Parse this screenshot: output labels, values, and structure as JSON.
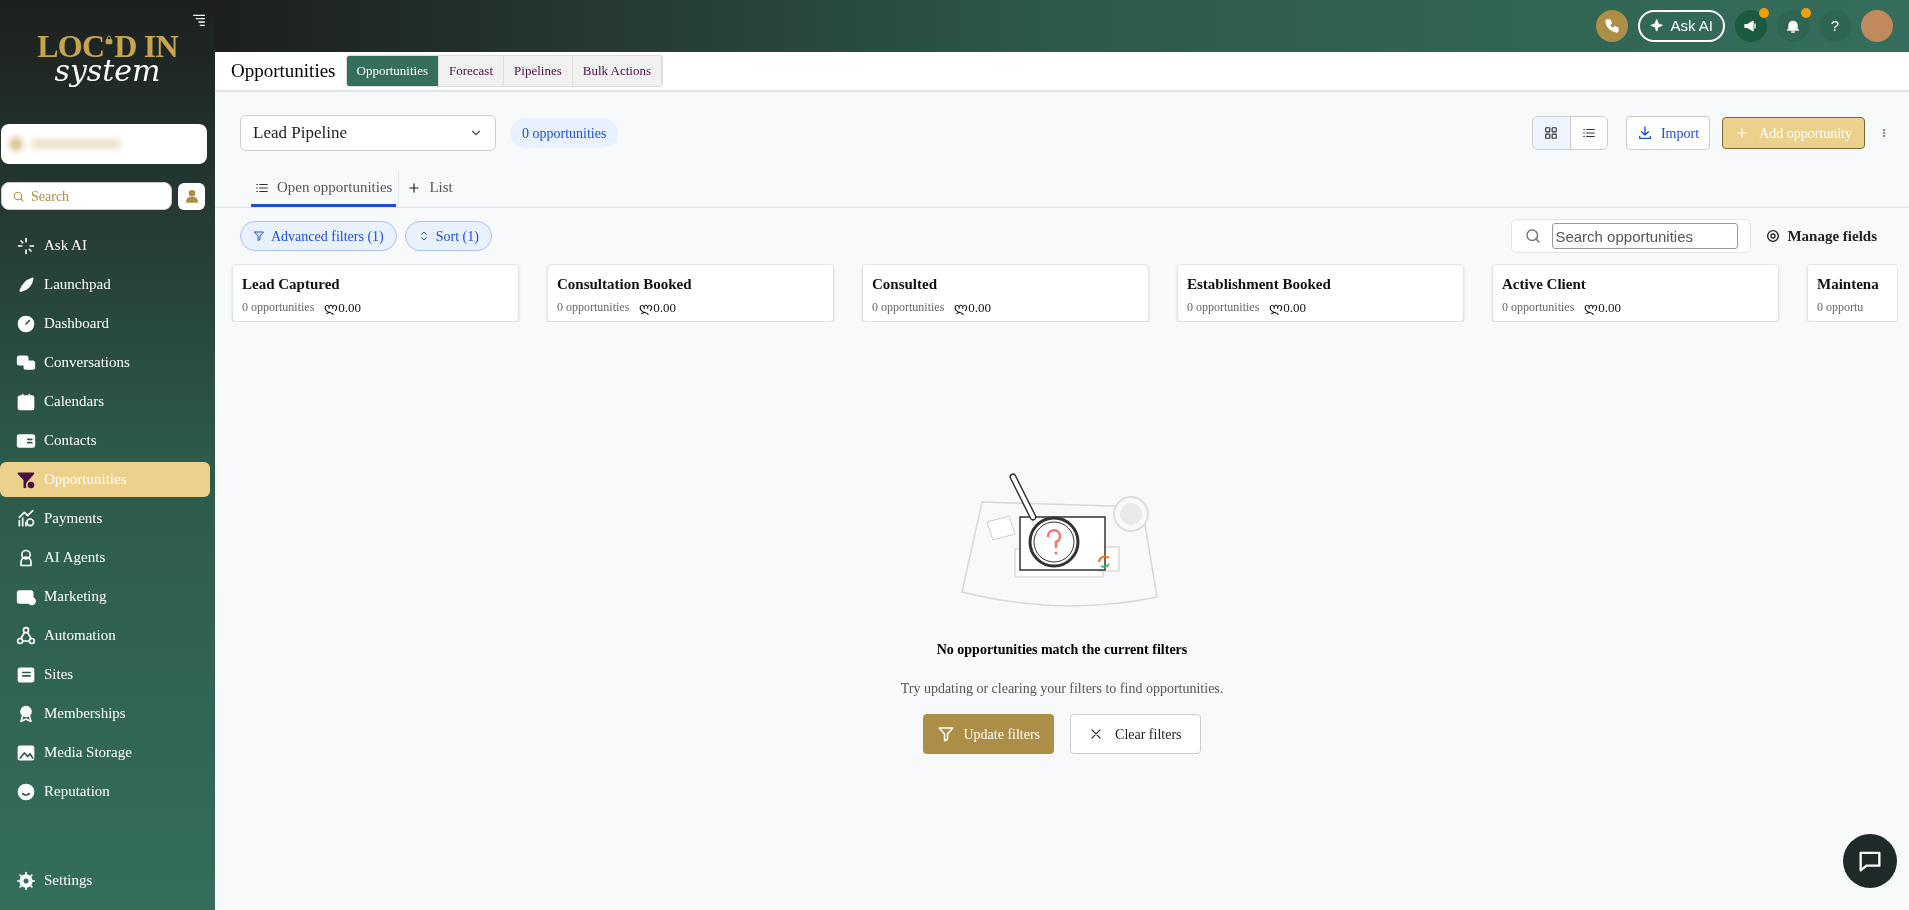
{
  "logo": {
    "top_left": "LOC",
    "top_right": "D IN",
    "script": "system"
  },
  "sidebar": {
    "search": {
      "placeholder": "Search"
    },
    "items": [
      {
        "label": "Ask AI",
        "selected": false
      },
      {
        "label": "Launchpad",
        "selected": false
      },
      {
        "label": "Dashboard",
        "selected": false
      },
      {
        "label": "Conversations",
        "selected": false
      },
      {
        "label": "Calendars",
        "selected": false
      },
      {
        "label": "Contacts",
        "selected": false
      },
      {
        "label": "Opportunities",
        "selected": true
      },
      {
        "label": "Payments",
        "selected": false
      },
      {
        "label": "AI Agents",
        "selected": false
      },
      {
        "label": "Marketing",
        "selected": false
      },
      {
        "label": "Automation",
        "selected": false
      },
      {
        "label": "Sites",
        "selected": false
      },
      {
        "label": "Memberships",
        "selected": false
      },
      {
        "label": "Media Storage",
        "selected": false
      },
      {
        "label": "Reputation",
        "selected": false
      }
    ],
    "footer_item": {
      "label": "Settings"
    }
  },
  "topbar": {
    "ask_ai": "Ask AI",
    "help": "?",
    "announcement_unread": true,
    "notification_unread": true
  },
  "page": {
    "title": "Opportunities",
    "tabs": [
      {
        "label": "Opportunities",
        "selected": true
      },
      {
        "label": "Forecast",
        "selected": false
      },
      {
        "label": "Pipelines",
        "selected": false
      },
      {
        "label": "Bulk Actions",
        "selected": false
      }
    ]
  },
  "toolbar": {
    "pipeline": "Lead Pipeline",
    "count": "0 opportunities",
    "grid_view": true,
    "import": "Import",
    "add": "Add opportunity"
  },
  "view_tabs": [
    {
      "label": "Open opportunities",
      "selected": true,
      "kind": "list"
    },
    {
      "label": "List",
      "selected": false,
      "kind": "add"
    }
  ],
  "filters": [
    {
      "label": "Advanced filters (1)",
      "kind": "filter"
    },
    {
      "label": "Sort (1)",
      "kind": "sort"
    }
  ],
  "search": {
    "placeholder": "Search opportunities"
  },
  "manage_fields": "Manage fields",
  "stages": [
    {
      "name": "Lead Captured",
      "count": "0 opportunities",
      "amount": "ლ0.00"
    },
    {
      "name": "Consultation Booked",
      "count": "0 opportunities",
      "amount": "ლ0.00"
    },
    {
      "name": "Consulted",
      "count": "0 opportunities",
      "amount": "ლ0.00"
    },
    {
      "name": "Establishment Booked",
      "count": "0 opportunities",
      "amount": "ლ0.00"
    },
    {
      "name": "Active Client",
      "count": "0 opportunities",
      "amount": "ლ0.00"
    },
    {
      "name": "Maintena",
      "count": "0 opportu"
    }
  ],
  "empty_state": {
    "title": "No opportunities match the current filters",
    "message": "Try updating or clearing your filters to find opportunities.",
    "primary": "Update filters",
    "secondary": "Clear filters"
  }
}
